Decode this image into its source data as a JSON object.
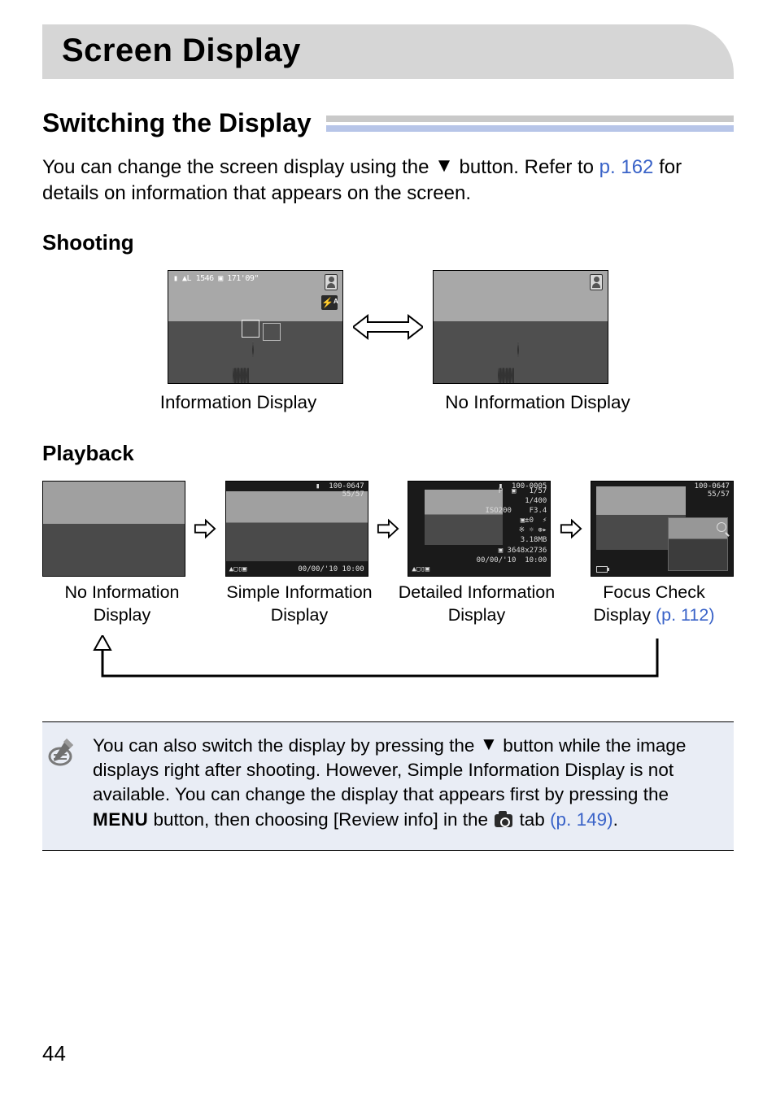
{
  "page_number": "44",
  "chapter_title": "Screen Display",
  "section_title": "Switching the Display",
  "intro": {
    "part1": "You can change the screen display using the ",
    "button_symbol": "▼",
    "part2": " button. Refer to ",
    "link": "p. 162",
    "part3": " for details on information that appears on the screen."
  },
  "shooting": {
    "heading": "Shooting",
    "thumb1_overlay_left": "▮ ▲L 1546 ▣ 171'09\"",
    "thumb1_flash": "⚡ᴬ",
    "caption_left": "Information Display",
    "caption_right": "No Information Display"
  },
  "playback": {
    "heading": "Playback",
    "thumb2_top": "▮  100-0647\n55/57",
    "thumb2_bot_left": "▲▢▯▣",
    "thumb2_bot_right": "00/00/'10  10:00",
    "thumb3_top": "▮  100-0005",
    "thumb3_right": "P  ▣   1/57\n     1/400\nISO200    F3.4\n▣±0  ⚡\n※ ☼ ⊕▸\n    3.18MB\n▣ 3648x2736\n00/00/'10  10:00",
    "thumb3_bot_left": "▲▢▯▣",
    "thumb4_top": "100-0647\n55/57",
    "captions": {
      "c1a": "No Information",
      "c1b": "Display",
      "c2a": "Simple Information",
      "c2b": "Display",
      "c3a": "Detailed Information",
      "c3b": "Display",
      "c4a": "Focus Check",
      "c4b": "Display ",
      "c4_link": "(p. 112)"
    }
  },
  "note": {
    "part1": "You can also switch the display by pressing the ",
    "button_symbol": "▼",
    "part2": " button while the image displays right after shooting. However, Simple Information Display is not available. You can change the display that appears first by pressing the ",
    "menu_label": "MENU",
    "part3": " button, then choosing [Review info] in the ",
    "part4": " tab ",
    "link": "(p. 149)",
    "part5": "."
  }
}
